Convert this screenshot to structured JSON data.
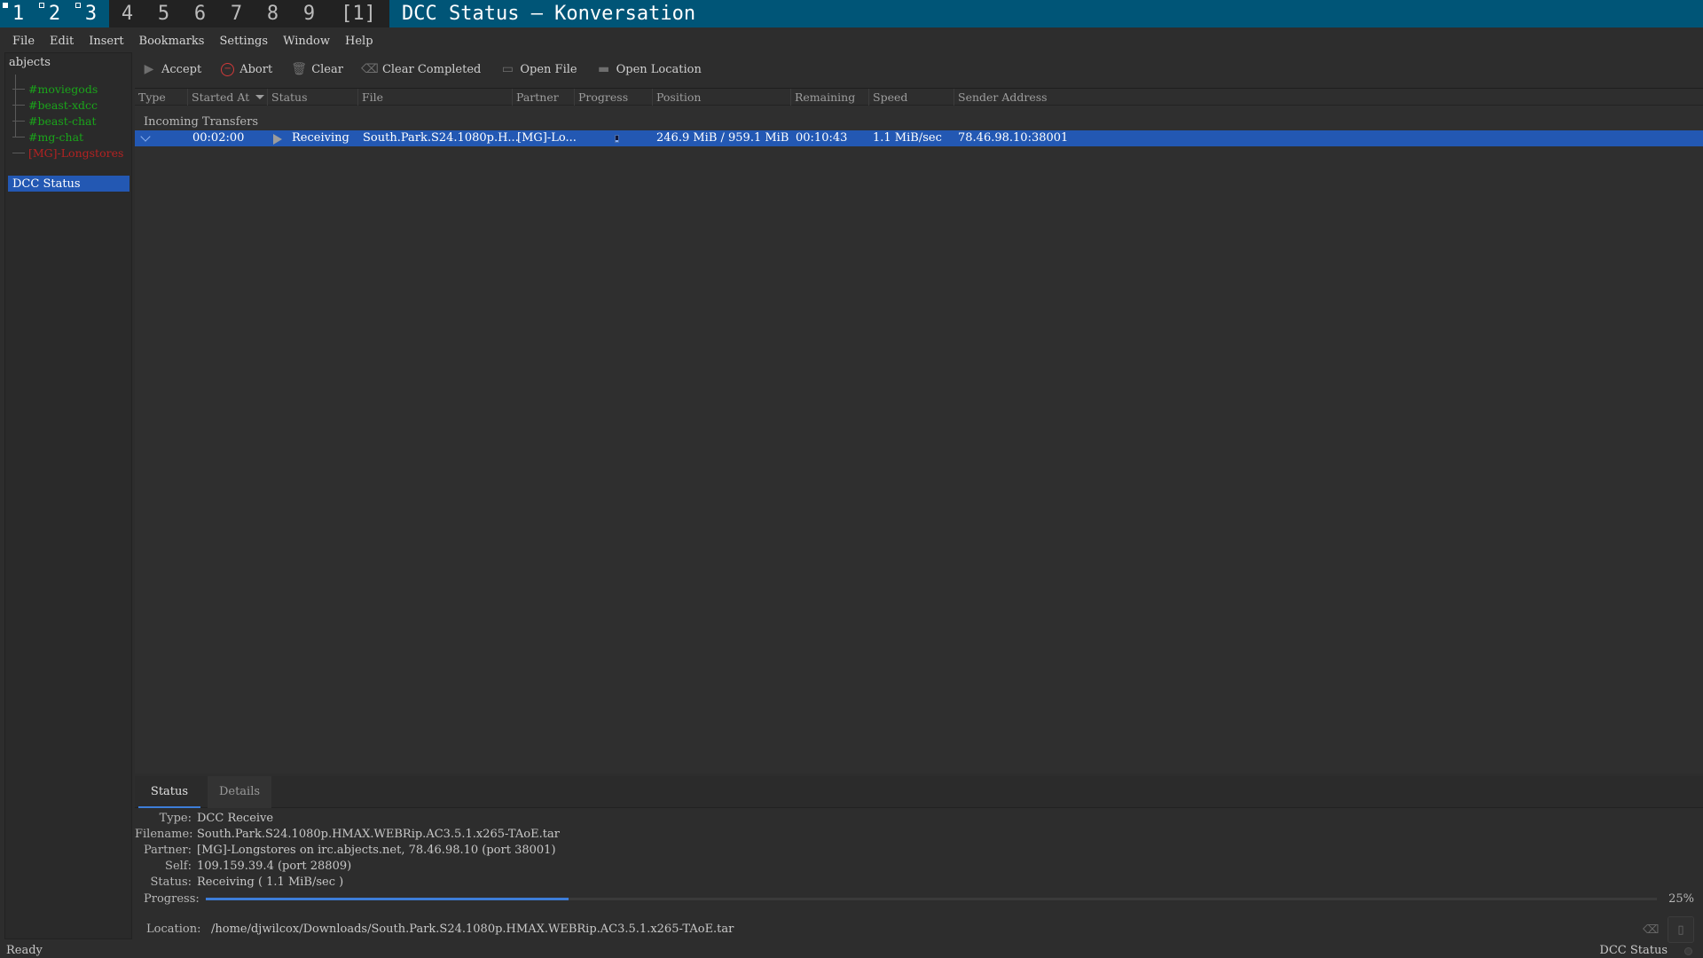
{
  "workspaces": [
    {
      "label": "1",
      "active": true,
      "mark": "filled"
    },
    {
      "label": "2",
      "active": true,
      "mark": "hollow"
    },
    {
      "label": "3",
      "active": true,
      "mark": "hollow"
    },
    {
      "label": "4",
      "active": false
    },
    {
      "label": "5",
      "active": false
    },
    {
      "label": "6",
      "active": false
    },
    {
      "label": "7",
      "active": false
    },
    {
      "label": "8",
      "active": false
    },
    {
      "label": "9",
      "active": false
    }
  ],
  "layout_indicator": "[1]",
  "window_title": "DCC Status — Konversation",
  "menu": [
    "File",
    "Edit",
    "Insert",
    "Bookmarks",
    "Settings",
    "Window",
    "Help"
  ],
  "sidebar": {
    "network": "abjects",
    "channels": [
      {
        "label": "#moviegods",
        "color": "green"
      },
      {
        "label": "#beast-xdcc",
        "color": "green"
      },
      {
        "label": "#beast-chat",
        "color": "green"
      },
      {
        "label": "#mg-chat",
        "color": "green"
      },
      {
        "label": "[MG]-Longstores",
        "color": "red"
      }
    ],
    "selected": "DCC Status"
  },
  "toolbar": {
    "accept": "Accept",
    "abort": "Abort",
    "clear": "Clear",
    "clear_completed": "Clear Completed",
    "open_file": "Open File",
    "open_location": "Open Location"
  },
  "table": {
    "headers": [
      "Type",
      "Started At",
      "Status",
      "File",
      "Partner",
      "Progress",
      "Position",
      "Remaining",
      "Speed",
      "Sender Address"
    ],
    "group": "Incoming Transfers",
    "row": {
      "started_at": "00:02:00",
      "status": "Receiving",
      "file": "South.Park.S24.1080p.H...",
      "partner": "[MG]-Lo...",
      "progress": 0.25,
      "position": "246.9 MiB / 959.1 MiB",
      "remaining": "00:10:43",
      "speed": "1.1 MiB/sec",
      "sender": "78.46.98.10:38001"
    }
  },
  "tabs": {
    "status": "Status",
    "details": "Details"
  },
  "details": {
    "type_label": "Type:",
    "type": "DCC Receive",
    "filename_label": "Filename:",
    "filename": "South.Park.S24.1080p.HMAX.WEBRip.AC3.5.1.x265-TAoE.tar",
    "partner_label": "Partner:",
    "partner": "[MG]-Longstores on irc.abjects.net, 78.46.98.10 (port 38001)",
    "self_label": "Self:",
    "self": "109.159.39.4 (port 28809)",
    "status_label": "Status:",
    "status": "Receiving ( 1.1 MiB/sec )",
    "progress_label": "Progress:",
    "progress": 0.25,
    "progress_text": "25%",
    "location_label": "Location:",
    "location": "/home/djwilcox/Downloads/South.Park.S24.1080p.HMAX.WEBRip.AC3.5.1.x265-TAoE.tar"
  },
  "statusbar": {
    "left": "Ready",
    "right": "DCC Status"
  },
  "colors": {
    "accent": "#005577",
    "selection": "#2358b3",
    "progress": "#3d7dd8",
    "channel_active": "#1aa51a",
    "channel_alert": "#b42222"
  },
  "icons": {
    "accept": "play-icon",
    "abort": "abort-icon",
    "clear": "trash-icon",
    "clear_completed": "clear-icon",
    "open_file": "file-icon",
    "open_location": "folder-icon"
  }
}
